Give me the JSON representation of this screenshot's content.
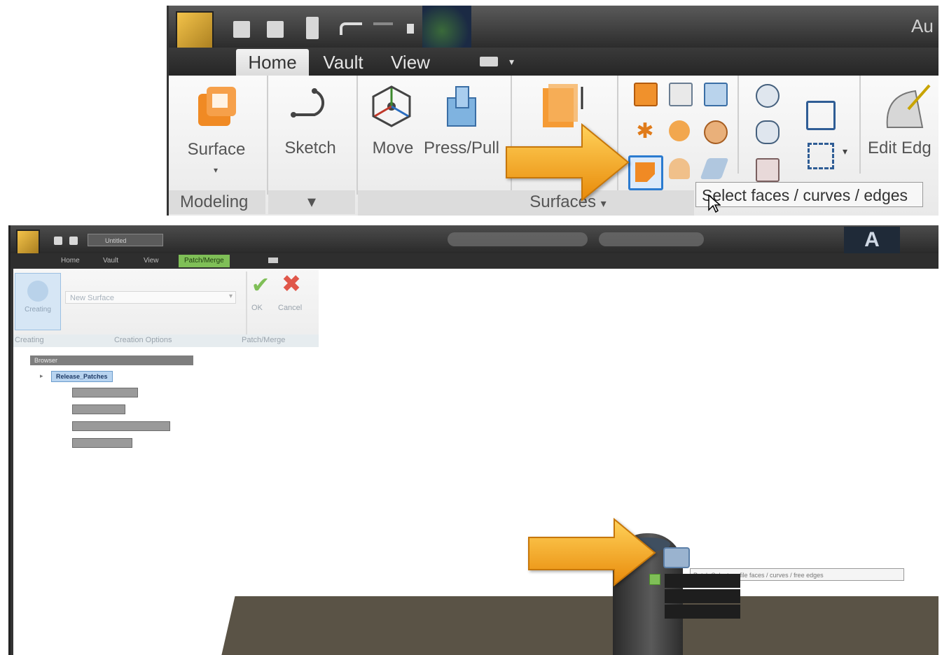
{
  "top_ribbon": {
    "title_fragment": "Au",
    "tabs": [
      "Home",
      "Vault",
      "View"
    ],
    "tools": {
      "surface": "Surface",
      "sketch": "Sketch",
      "move": "Move",
      "press_pull": "Press/Pull",
      "edit_edge": "Edit Edg"
    },
    "panels": {
      "modeling": "Modeling",
      "surfaces": "Surfaces"
    },
    "tooltip": "Select faces / curves / edges"
  },
  "bottom_window": {
    "title_box": "Untitled",
    "title_center": "",
    "tabs": [
      "Home",
      "Vault",
      "View",
      "Patch/Merge"
    ],
    "ribbon": {
      "new_surface_placeholder": "New Surface",
      "ok": "OK",
      "cancel": "Cancel",
      "group_creating": "Creating",
      "group_options": "Creation Options",
      "group_patch": "Patch/Merge"
    },
    "browser": {
      "header": "Browser",
      "root": "Release_Patches",
      "children": [
        "",
        "",
        "",
        ""
      ]
    },
    "marking_menu": {
      "tooltip": "Patch   Select profile faces / curves / free edges",
      "items": [
        "",
        "",
        ""
      ]
    }
  },
  "colors": {
    "accent_orange": "#f0a21c",
    "selection_blue": "#6aa6dc",
    "titlebar_dark": "#2c2c2c"
  }
}
